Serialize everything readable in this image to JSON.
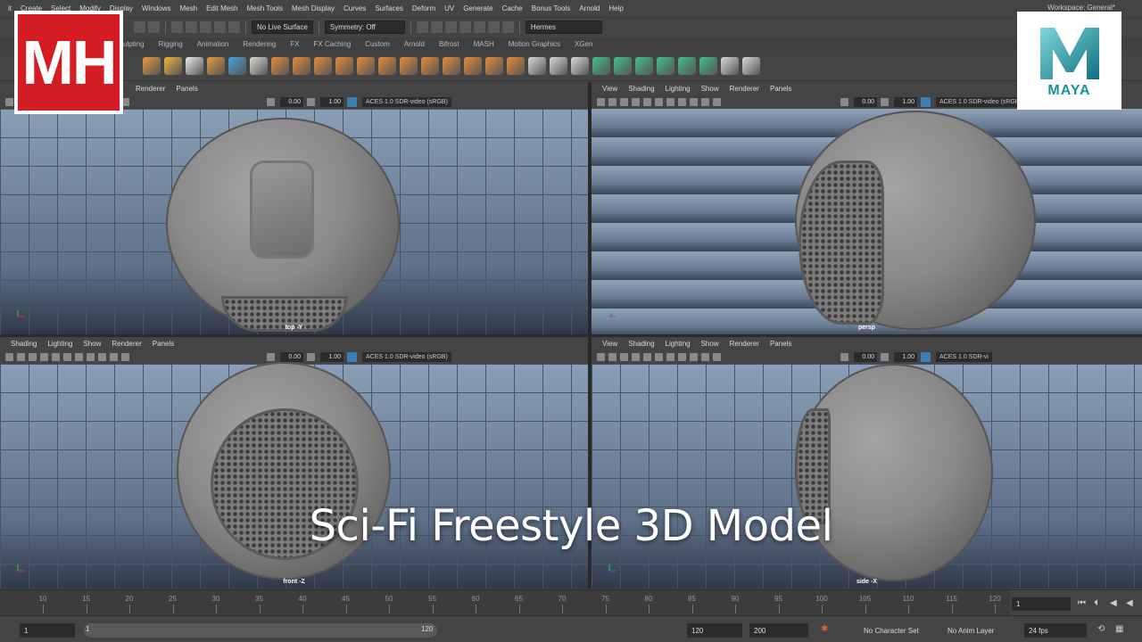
{
  "menu": [
    "it",
    "Create",
    "Select",
    "Modify",
    "Display",
    "Windows",
    "Mesh",
    "Edit Mesh",
    "Mesh Tools",
    "Mesh Display",
    "Curves",
    "Surfaces",
    "Deform",
    "UV",
    "Generate",
    "Cache",
    "Bonus Tools",
    "Arnold",
    "Help"
  ],
  "workspace": "Workspace: General*",
  "statusline": {
    "live_surface": "No Live Surface",
    "symmetry": "Symmetry: Off",
    "user": "Hermes"
  },
  "shelf_tabs": [
    "ulpting",
    "Rigging",
    "Animation",
    "Rendering",
    "FX",
    "FX Caching",
    "Custom",
    "Arnold",
    "Bifrost",
    "MASH",
    "Motion Graphics",
    "XGen"
  ],
  "viewports": [
    {
      "menu": [
        "Renderer",
        "Panels"
      ],
      "exposure": "0.00",
      "gamma": "1.00",
      "color_space": "ACES 1.0 SDR-video (sRGB)",
      "label": "top -Y"
    },
    {
      "menu": [
        "View",
        "Shading",
        "Lighting",
        "Show",
        "Renderer",
        "Panels"
      ],
      "exposure": "0.00",
      "gamma": "1.00",
      "color_space": "ACES 1.0 SDR-video (sRGB)",
      "label": "persp"
    },
    {
      "menu": [
        "Shading",
        "Lighting",
        "Show",
        "Renderer",
        "Panels"
      ],
      "exposure": "0.00",
      "gamma": "1.00",
      "color_space": "ACES 1.0 SDR-video (sRGB)",
      "label": "front -Z"
    },
    {
      "menu": [
        "View",
        "Shading",
        "Lighting",
        "Show",
        "Renderer",
        "Panels"
      ],
      "exposure": "0.00",
      "gamma": "1.00",
      "color_space": "ACES 1.0 SDR-vi",
      "label": "side -X"
    }
  ],
  "overlay_title": "Sci-Fi Freestyle 3D Model",
  "logos": {
    "mh": "MH",
    "maya": "MAYA"
  },
  "timeline": {
    "ticks": [
      "10",
      "15",
      "20",
      "25",
      "30",
      "35",
      "40",
      "45",
      "50",
      "55",
      "60",
      "65",
      "70",
      "75",
      "80",
      "85",
      "90",
      "95",
      "100",
      "105",
      "110",
      "115",
      "120"
    ],
    "current_frame": "1"
  },
  "range": {
    "start": "1",
    "slider_start": "1",
    "slider_end": "120",
    "end": "120",
    "anim_end": "200",
    "character_set": "No Character Set",
    "anim_layer": "No Anim Layer",
    "fps": "24 fps"
  },
  "colors": {
    "mh_red": "#d41d23",
    "maya_teal": "#1a8fa0",
    "viewport_bg": "#6a7f97"
  }
}
